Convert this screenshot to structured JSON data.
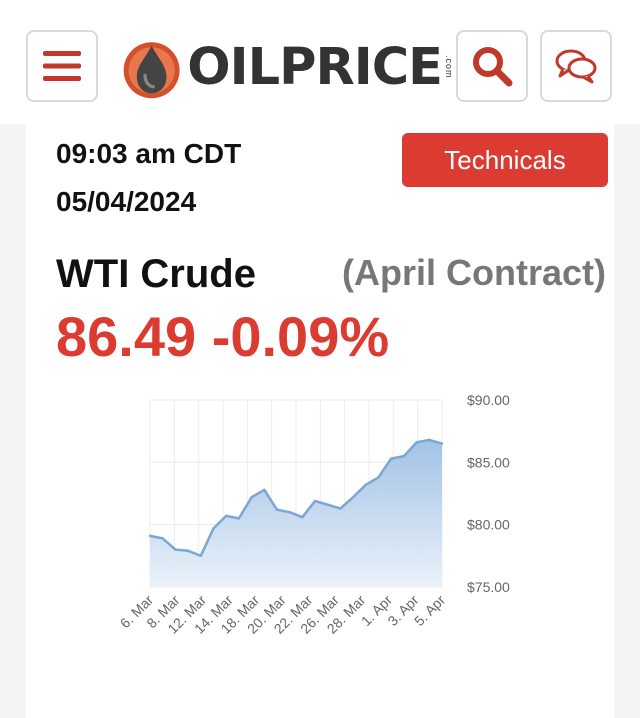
{
  "header": {
    "logo_text": "OILPRICE",
    "logo_suffix": ".com",
    "menu_icon": "hamburger-icon",
    "search_icon": "search-icon",
    "chat_icon": "chat-bubbles-icon",
    "brand_color": "#c0392b"
  },
  "quote": {
    "time": "09:03 am CDT",
    "date": "05/04/2024",
    "technicals_label": "Technicals",
    "name": "WTI Crude",
    "contract": "(April Contract)",
    "price_change": "86.49 -0.09%",
    "accent_color": "#dc3b32"
  },
  "chart_data": {
    "type": "area",
    "x": [
      "6. Mar",
      "7. Mar",
      "8. Mar",
      "11. Mar",
      "12. Mar",
      "13. Mar",
      "14. Mar",
      "15. Mar",
      "18. Mar",
      "19. Mar",
      "20. Mar",
      "21. Mar",
      "22. Mar",
      "25. Mar",
      "26. Mar",
      "27. Mar",
      "28. Mar",
      "1. Apr",
      "2. Apr",
      "3. Apr",
      "4. Apr",
      "5. Apr"
    ],
    "x_ticks": [
      "6. Mar",
      "8. Mar",
      "12. Mar",
      "14. Mar",
      "18. Mar",
      "20. Mar",
      "22. Mar",
      "26. Mar",
      "28. Mar",
      "1. Apr",
      "3. Apr",
      "5. Apr"
    ],
    "values": [
      79.1,
      78.9,
      78.0,
      77.9,
      77.5,
      79.7,
      80.7,
      80.5,
      82.2,
      82.8,
      81.2,
      81.0,
      80.6,
      81.9,
      81.6,
      81.3,
      82.2,
      83.2,
      83.8,
      85.3,
      85.5,
      86.6,
      86.8,
      86.5
    ],
    "y_ticks": [
      "$75.00",
      "$80.00",
      "$85.00",
      "$90.00"
    ],
    "ylim": [
      75,
      90
    ],
    "line_color": "#7aa7d6",
    "fill_color": "#b8d1ee",
    "grid": true
  }
}
